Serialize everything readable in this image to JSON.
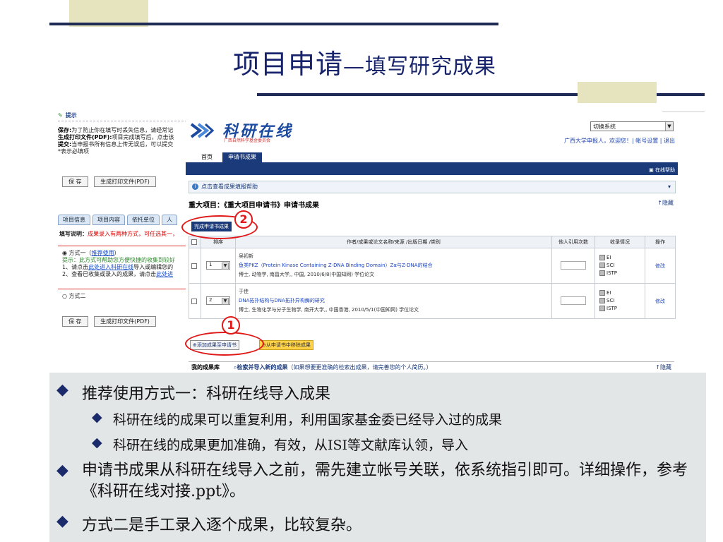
{
  "slide": {
    "title_main": "项目申请",
    "title_sub": "—填写研究成果"
  },
  "left_panel": {
    "tip_header": "提示",
    "tip_lines": [
      {
        "label": "保存:",
        "text": "为了防止你在填写时丢失信息，请经常记"
      },
      {
        "label": "生成打印文件(PDF):",
        "text": "项目完成填写后，点击该"
      },
      {
        "label": "提交:",
        "text": "当申报书所有信息上传无误后，可以提交"
      },
      {
        "label": "",
        "text": "*表示必填项"
      }
    ],
    "save_label": "保 存",
    "pdf_label": "生成打印文件(PDF)",
    "tabs": [
      "项目信息",
      "项目内容",
      "依托单位",
      "人"
    ],
    "fill_note_label": "填写说明：",
    "fill_note_text": "成果录入有两种方式，可任选其一，",
    "method1_label": "方式一（",
    "method1_rec": "推荐使用",
    "method1_close": "）",
    "method1_tip": "提示：此方式可帮助您方便快捷的收集到较好",
    "method1_step1_a": "1、请点击",
    "method1_step1_link": "此处进入科研在线",
    "method1_step1_b": "导入或编辑您的",
    "method1_step2_a": "2、查看已收集或录入的成果，请点击",
    "method1_step2_link": "此处进",
    "method2_label": "方式二"
  },
  "main": {
    "logo_text": "科研在线",
    "logo_sub": "广西自然科学基金委员会",
    "switch_label": "切换系统",
    "user_line": "广西大学申报人，欢迎您！| 帐号设置 | 退出",
    "nav_tabs": [
      "首页",
      "申请书成果"
    ],
    "help_link": "在线帮助",
    "helpbar_text": "点击查看成果填报帮助",
    "section_title": "重大项目：《重大项目申请书》申请书成果",
    "hide_label": "↑隐藏",
    "complete_button": "完成申请书成果",
    "table_headers": [
      "排序",
      "作者/成果或论文名称/来源 /出版日期 /类别",
      "他人引用次数",
      "收录情况",
      "操作"
    ],
    "rows": [
      {
        "order": "1",
        "author": "吴初新",
        "title": "鱼类PKZ（Protein Kinase Containing Z-DNA Binding Domain）Zα与Z-DNA的结合",
        "meta": "博士, 动物学, 南昌大学,, 中国, 2010/6/8(中国知网) 学位论文",
        "index": [
          "EI",
          "SCI",
          "ISTP"
        ],
        "action": "修改"
      },
      {
        "order": "2",
        "author": "于佳",
        "title": "DNA拓扑结构与DNA拓扑异构酶的研究",
        "meta": "博士, 生物化学与分子生物学, 南开大学,, 中国香港, 2010/5/1(中国知网) 学位论文",
        "index": [
          "EI",
          "SCI",
          "ISTP"
        ],
        "action": "修改"
      }
    ],
    "add_button": "添加成果至申请书",
    "remove_button": "从申请书中移除成果",
    "lib_tab": "我的成果库",
    "lib_search": "检索并导入新的成果",
    "lib_search_note": "（如果想要更准确的检索出成果，请完善您的个人简历。）",
    "lib_hide": "↑隐藏"
  },
  "callouts": {
    "one": "1",
    "two": "2"
  },
  "bullets": {
    "b1": "推荐使用方式一：科研在线导入成果",
    "b2": "科研在线的成果可以重复利用，利用国家基金委已经导入过的成果",
    "b3": "科研在线的成果更加准确，有效，从ISI等文献库认领，导入",
    "b4": "申请书成果从科研在线导入之前，需先建立帐号关联，依系统指引即可。详细操作，参考《科研在线对接.ppt》。",
    "b5": "方式二是手工录入逐个成果，比较复杂。"
  },
  "colors": {
    "navy": "#1b3a7a",
    "title": "#17246b",
    "accent_red": "#e01818",
    "deco": "#e6e4bf"
  }
}
